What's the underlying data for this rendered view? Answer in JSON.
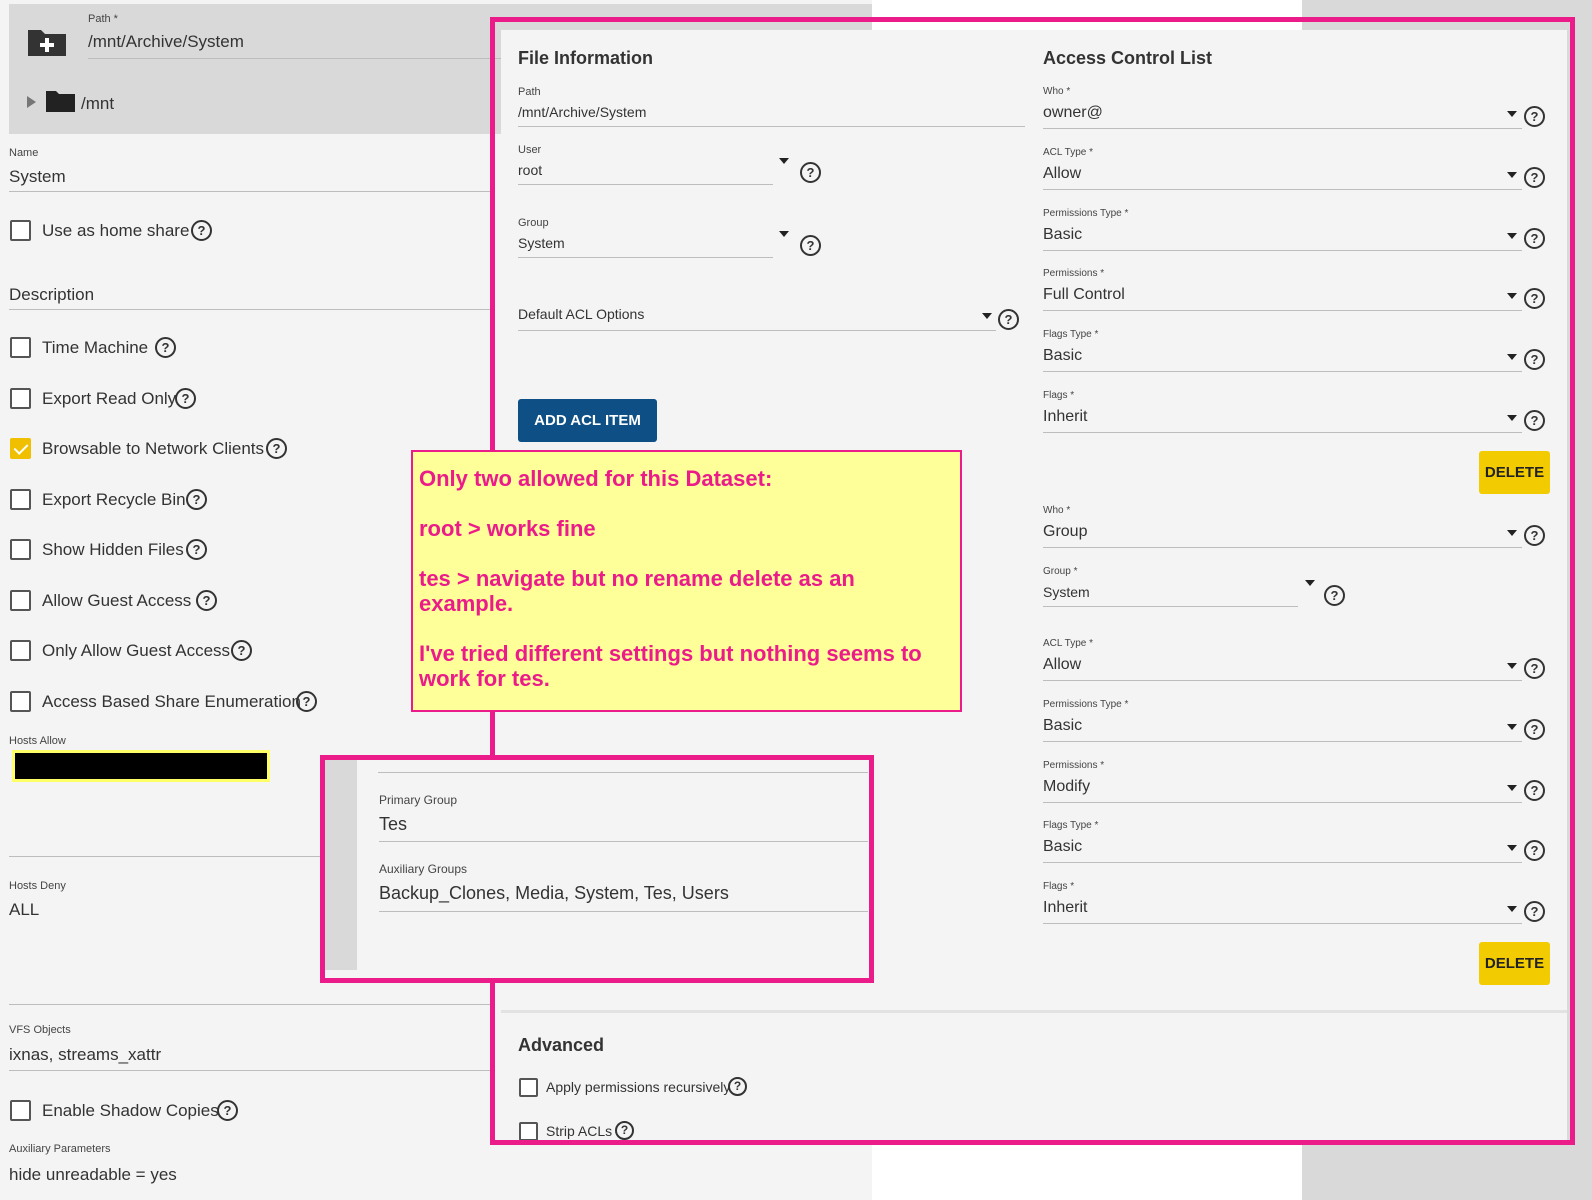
{
  "path_selector": {
    "label": "Path *",
    "value": "/mnt/Archive/System",
    "tree_item": "/mnt"
  },
  "share": {
    "name_label": "Name",
    "name_value": "System",
    "home_share_label": "Use as home share",
    "description_label": "Description",
    "time_machine_label": "Time Machine",
    "export_read_only_label": "Export Read Only",
    "browsable_label": "Browsable to Network Clients",
    "browsable_checked": true,
    "recycle_bin_label": "Export Recycle Bin",
    "hidden_files_label": "Show Hidden Files",
    "guest_access_label": "Allow Guest Access",
    "only_guest_label": "Only Allow Guest Access",
    "abe_label": "Access Based Share Enumeration",
    "hosts_allow_label": "Hosts Allow",
    "hosts_deny_label": "Hosts Deny",
    "hosts_deny_value": "ALL",
    "vfs_label": "VFS Objects",
    "vfs_value": "ixnas, streams_xattr",
    "shadow_copies_label": "Enable Shadow Copies",
    "aux_params_label": "Auxiliary Parameters",
    "aux_params_value": "hide unreadable = yes"
  },
  "file_info": {
    "title": "File Information",
    "path_label": "Path",
    "path_value": "/mnt/Archive/System",
    "user_label": "User",
    "user_value": "root",
    "group_label": "Group",
    "group_value": "System",
    "default_acl_label": "Default ACL Options",
    "add_acl_button": "ADD ACL ITEM"
  },
  "acl": {
    "title": "Access Control List",
    "delete_label": "DELETE",
    "entry1": {
      "who_label": "Who *",
      "who_value": "owner@",
      "type_label": "ACL Type *",
      "type_value": "Allow",
      "perm_type_label": "Permissions Type *",
      "perm_type_value": "Basic",
      "perm_label": "Permissions *",
      "perm_value": "Full Control",
      "flags_type_label": "Flags Type *",
      "flags_type_value": "Basic",
      "flags_label": "Flags *",
      "flags_value": "Inherit"
    },
    "entry2": {
      "who_label": "Who *",
      "who_value": "Group",
      "group_label": "Group *",
      "group_value": "System",
      "type_label": "ACL Type *",
      "type_value": "Allow",
      "perm_type_label": "Permissions Type *",
      "perm_type_value": "Basic",
      "perm_label": "Permissions *",
      "perm_value": "Modify",
      "flags_type_label": "Flags Type *",
      "flags_type_value": "Basic",
      "flags_label": "Flags *",
      "flags_value": "Inherit"
    }
  },
  "advanced": {
    "title": "Advanced",
    "recursive_label": "Apply permissions recursively",
    "strip_label": "Strip ACLs"
  },
  "user_info": {
    "primary_group_label": "Primary Group",
    "primary_group_value": "Tes",
    "aux_groups_label": "Auxiliary Groups",
    "aux_groups_value": "Backup_Clones, Media, System, Tes, Users"
  },
  "annotation": {
    "line1": "Only two allowed for this Dataset:",
    "line2": "root > works fine",
    "line3": "tes > navigate but no rename delete as an example.",
    "line4": "I've tried different settings but nothing seems to work for tes."
  },
  "colors": {
    "accent_pink": "#ec1b8a",
    "note_yellow": "#ffff99",
    "primary_button": "#0e4f86",
    "delete_button": "#f2cc00",
    "checkbox_checked": "#f0c000"
  }
}
